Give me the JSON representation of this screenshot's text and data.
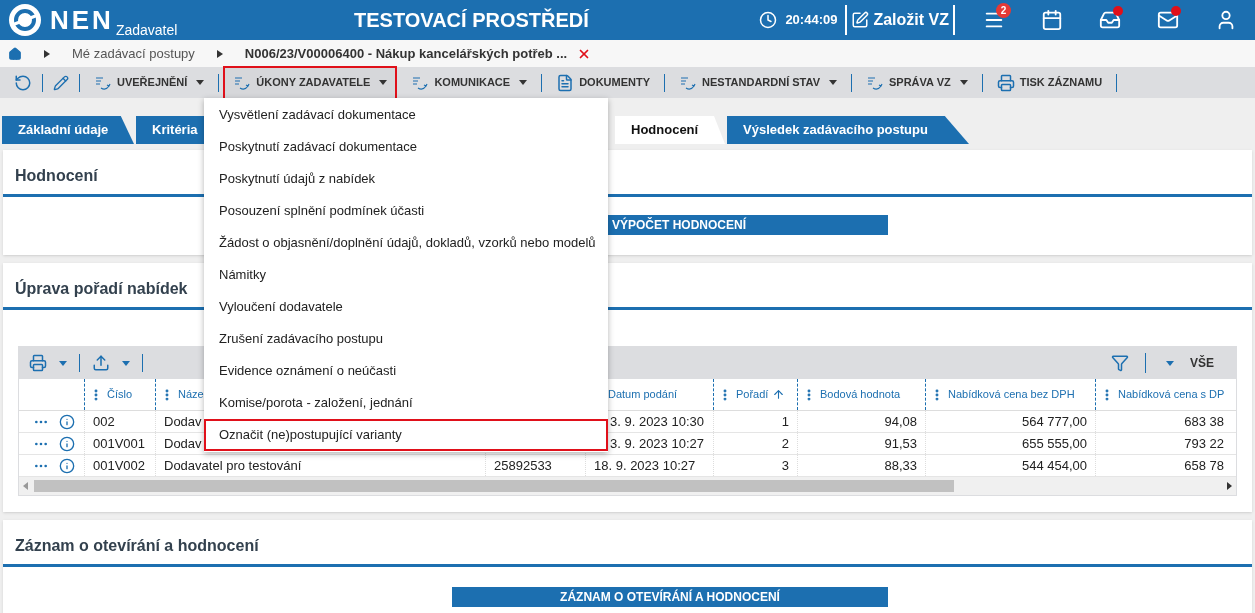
{
  "header": {
    "logo": "NEN",
    "subtitle": "Zadavatel",
    "environment": "TESTOVACÍ PROSTŘEDÍ",
    "time": "20:44:09",
    "create_button": "Založit VZ",
    "icons": [
      {
        "kind": "menu",
        "badge": "2",
        "notification": false
      },
      {
        "kind": "calendar",
        "notification": false
      },
      {
        "kind": "inbox",
        "notification": true
      },
      {
        "kind": "mail",
        "notification": true
      },
      {
        "kind": "user",
        "notification": false
      }
    ]
  },
  "breadcrumb": [
    {
      "label": "Mé zadávací postupy",
      "current": false
    },
    {
      "label": "N006/23/V00006400 - Nákup kancelářských potřeb ...",
      "current": true
    }
  ],
  "toolbar": [
    {
      "kind": "refresh"
    },
    {
      "kind": "edit"
    },
    {
      "kind": "menu",
      "label": "UVEŘEJNĚNÍ",
      "selected": false
    },
    {
      "kind": "menu",
      "label": "ÚKONY ZADAVATELE",
      "selected": true
    },
    {
      "kind": "menu",
      "label": "KOMUNIKACE",
      "selected": false
    },
    {
      "kind": "document",
      "label": "DOKUMENTY",
      "selected": false
    },
    {
      "kind": "menu",
      "label": "NESTANDARDNÍ STAV",
      "selected": false
    },
    {
      "kind": "menu",
      "label": "SPRÁVA VZ",
      "selected": false
    },
    {
      "kind": "print",
      "label": "TISK ZÁZNAMU",
      "selected": false
    }
  ],
  "tabs": [
    {
      "label": "Základní údaje",
      "selected": false
    },
    {
      "label": "Kritéria",
      "selected": false
    },
    {
      "label": "Hodnocení",
      "selected": true
    },
    {
      "label": "Výsledek zadávacího postupu",
      "selected": false
    }
  ],
  "dropdown": [
    {
      "label": "Vysvětlení zadávací dokumentace",
      "selected": false
    },
    {
      "label": "Poskytnutí zadávací dokumentace",
      "selected": false
    },
    {
      "label": "Poskytnutí údajů z nabídek",
      "selected": false
    },
    {
      "label": "Posouzení splnění podmínek účasti",
      "selected": false
    },
    {
      "label": "Žádost o objasnění/doplnění údajů, dokladů, vzorků nebo modelů",
      "selected": false
    },
    {
      "label": "Námitky",
      "selected": false
    },
    {
      "label": "Vyloučení dodavatele",
      "selected": false
    },
    {
      "label": "Zrušení zadávacího postupu",
      "selected": false
    },
    {
      "label": "Evidence oznámení o neúčasti",
      "selected": false
    },
    {
      "label": "Komise/porota - založení, jednání",
      "selected": false
    },
    {
      "label": "Označit (ne)postupující varianty",
      "selected": true
    }
  ],
  "evaluation": {
    "title": "Hodnocení",
    "button": "VÝPOČET HODNOCENÍ"
  },
  "ranking": {
    "title": "Úprava pořadí nabídek",
    "filter_label": "VŠE",
    "columns": [
      {
        "label": "Číslo",
        "sorted": false
      },
      {
        "label": "Náze",
        "sorted": false
      },
      {
        "label": "Datum podání",
        "sorted": false
      },
      {
        "label": "Pořadí",
        "sorted": true
      },
      {
        "label": "Bodová hodnota",
        "sorted": false
      },
      {
        "label": "Nabídková cena bez DPH",
        "sorted": false
      },
      {
        "label": "Nabídková cena s DP",
        "sorted": false
      }
    ],
    "rows": [
      {
        "number": "002",
        "name": "Dodav",
        "date": "3. 9. 2023 10:30",
        "rank": "1",
        "points": "94,08",
        "price": "564 777,00",
        "price_vat": "683 38"
      },
      {
        "number": "001V001",
        "name": "Dodav",
        "date": "3. 9. 2023 10:27",
        "rank": "2",
        "points": "91,53",
        "price": "655 555,00",
        "price_vat": "793 22"
      },
      {
        "number": "001V002",
        "name": "Dodavatel pro testování",
        "ico": "25892533",
        "date": "18. 9. 2023 10:27",
        "rank": "3",
        "points": "88,33",
        "price": "544 454,00",
        "price_vat": "658 78"
      }
    ]
  },
  "record": {
    "title": "Záznam o otevírání a hodnocení",
    "button": "ZÁZNAM O OTEVÍRÁNÍ A HODNOCENÍ"
  }
}
